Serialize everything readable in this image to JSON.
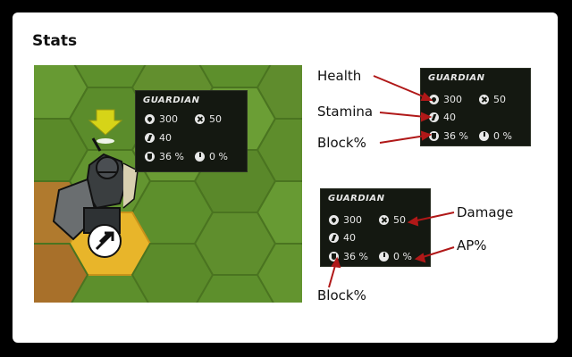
{
  "page": {
    "title": "Stats"
  },
  "scene": {
    "panel": {
      "title": "GUARDIAN",
      "health": "300",
      "damage": "50",
      "stamina": "40",
      "block": "36 %",
      "ap": "0 %"
    }
  },
  "legend_top": {
    "panel": {
      "title": "GUARDIAN",
      "health": "300",
      "damage": "50",
      "stamina": "40",
      "block": "36 %",
      "ap": "0 %"
    },
    "labels": {
      "health": "Health",
      "stamina": "Stamina",
      "block": "Block%"
    }
  },
  "legend_bottom": {
    "panel": {
      "title": "GUARDIAN",
      "health": "300",
      "damage": "50",
      "stamina": "40",
      "block": "36 %",
      "ap": "0 %"
    },
    "labels": {
      "damage": "Damage",
      "ap": "AP%",
      "block": "Block%"
    }
  },
  "colors": {
    "arrow": "#b01818",
    "panel_bg": "#141811",
    "hex_highlight": "#e8b52a",
    "grass": "#5a8a2a",
    "marker": "#d6d418"
  }
}
